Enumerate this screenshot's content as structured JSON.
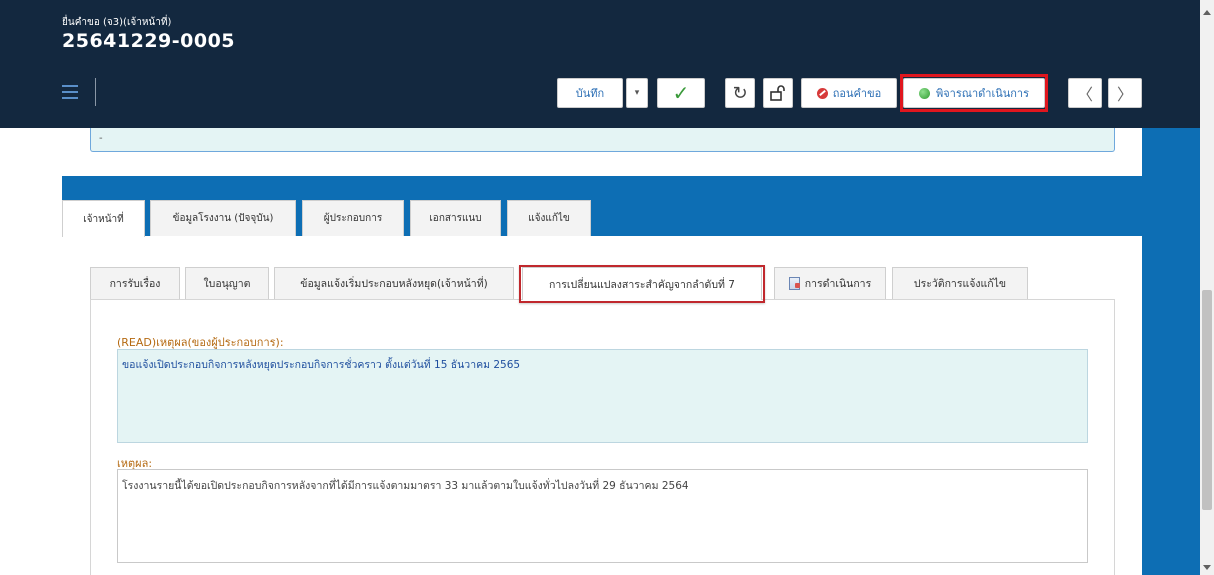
{
  "header": {
    "subtitle": "ยื่นคำขอ (จ3)(เจ้าหน้าที่)",
    "request_id": "25641229-0005"
  },
  "toolbar": {
    "save_label": "บันทึก",
    "caret": "▾",
    "check": "✓",
    "refresh": "↻",
    "withdraw_label": "ถอนคำขอ",
    "proceed_label": "พิจารณาดำเนินการ",
    "prev": "〈",
    "next": "〉",
    "icons": [
      "hamburger-menu-icon",
      "check-icon",
      "refresh-icon",
      "unlock-icon",
      "cancel-icon",
      "green-dot-icon",
      "chevron-left-icon",
      "chevron-right-icon"
    ],
    "highlight_color": "#e0161e"
  },
  "top_field": {
    "value": "-"
  },
  "outer_tabs": [
    {
      "label": "เจ้าหน้าที่",
      "active": true
    },
    {
      "label": "ข้อมูลโรงงาน (ปัจจุบัน)",
      "active": false
    },
    {
      "label": "ผู้ประกอบการ",
      "active": false
    },
    {
      "label": "เอกสารแนบ",
      "active": false
    },
    {
      "label": "แจ้งแก้ไข",
      "active": false
    }
  ],
  "inner_tabs": [
    {
      "label": "การรับเรื่อง",
      "active": false
    },
    {
      "label": "ใบอนุญาต",
      "active": false
    },
    {
      "label": "ข้อมูลแจ้งเริ่มประกอบหลังหยุด(เจ้าหน้าที่)",
      "active": false
    },
    {
      "label": "การเปลี่ยนแปลงสาระสำคัญจากลำดับที่ 7",
      "active": true
    },
    {
      "label": "การดำเนินการ",
      "active": false
    },
    {
      "label": "ประวัติการแจ้งแก้ไข",
      "active": false
    }
  ],
  "form": {
    "read_reason_label": "(READ)เหตุผล(ของผู้ประกอบการ):",
    "read_reason_value": "ขอแจ้งเปิดประกอบกิจการหลังหยุดประกอบกิจการชั่วคราว ตั้งแต่วันที่ 15 ธันวาคม 2565",
    "reason_label": "เหตุผล:",
    "reason_value": "โรงงานรายนี้ได้ขอเปิดประกอบกิจการหลังจากที่ได้มีการแจ้งตามมาตรา 33 มาแล้วตามใบแจ้งทั่วไปลงวันที่ 29 ธันวาคม 2564"
  },
  "colors": {
    "header_bg": "#13283f",
    "main_bg": "#0d6eb4",
    "field_bg": "#e4f4f4",
    "label_color": "#b56a12",
    "link_color": "#1e4e9e"
  }
}
